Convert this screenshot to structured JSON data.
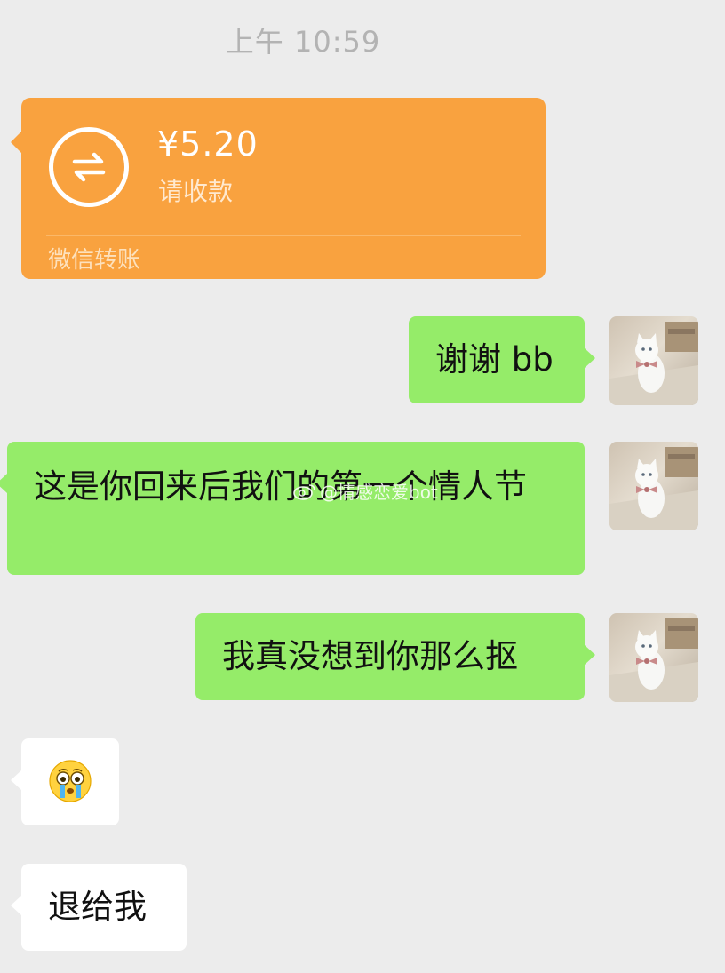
{
  "header": {
    "timestamp": "上午 10:59"
  },
  "transfer": {
    "amount": "¥5.20",
    "status": "请收款",
    "footer": "微信转账",
    "accent_color": "#f9a23f",
    "icon": "transfer-arrows-icon"
  },
  "messages": [
    {
      "side": "right",
      "text": "谢谢 bb"
    },
    {
      "side": "left",
      "text": "这是你回来后我们的第一个情人节"
    },
    {
      "side": "right",
      "text": "我真没想到你那么抠"
    },
    {
      "side": "left",
      "text": "",
      "emoji": "crying-face-emoji"
    },
    {
      "side": "left",
      "text": "退给我"
    }
  ],
  "avatar": {
    "icon": "white-cat-avatar"
  },
  "watermark": {
    "text": "@情感恋爱bot"
  },
  "colors": {
    "background": "#ececec",
    "sent_bubble": "#95ec69",
    "received_bubble": "#ffffff"
  }
}
